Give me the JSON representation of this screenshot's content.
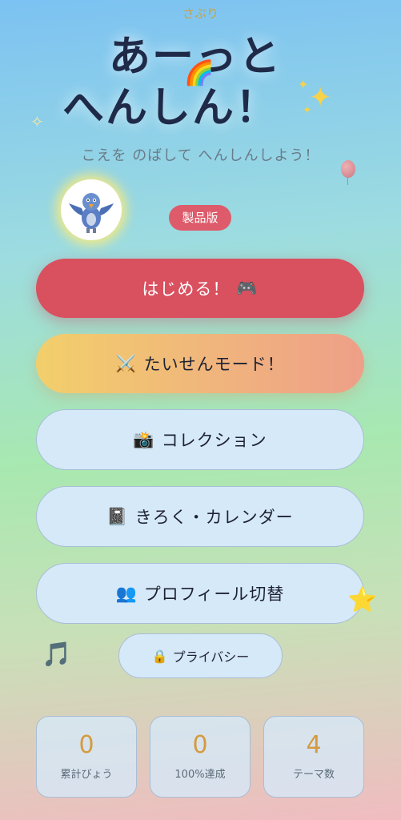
{
  "brand": "さぷり",
  "title": {
    "line1": "あーっと",
    "line2": "へんしん！"
  },
  "subtitle": "こえを のばして へんしんしよう！",
  "badge": "製品版",
  "buttons": {
    "start": {
      "label": "はじめる！",
      "icon": "🎮"
    },
    "battle": {
      "label": "たいせんモード！",
      "icon": "⚔️"
    },
    "collection": {
      "label": "コレクション",
      "icon": "📸"
    },
    "calendar": {
      "label": "きろく・カレンダー",
      "icon": "📓"
    },
    "profile": {
      "label": "プロフィール切替",
      "icon": "👥"
    },
    "privacy": {
      "label": "プライバシー",
      "icon": "🔒"
    }
  },
  "stats": [
    {
      "value": "0",
      "label": "累計びょう"
    },
    {
      "value": "0",
      "label": "100%達成"
    },
    {
      "value": "4",
      "label": "テーマ数"
    }
  ],
  "decor": {
    "rainbow": "🌈",
    "sparkle": "✨",
    "note": "🎵",
    "star": "⭐"
  },
  "colors": {
    "primary": "#d9505f",
    "accent": "#d69a3e",
    "title": "#1f2a48"
  }
}
